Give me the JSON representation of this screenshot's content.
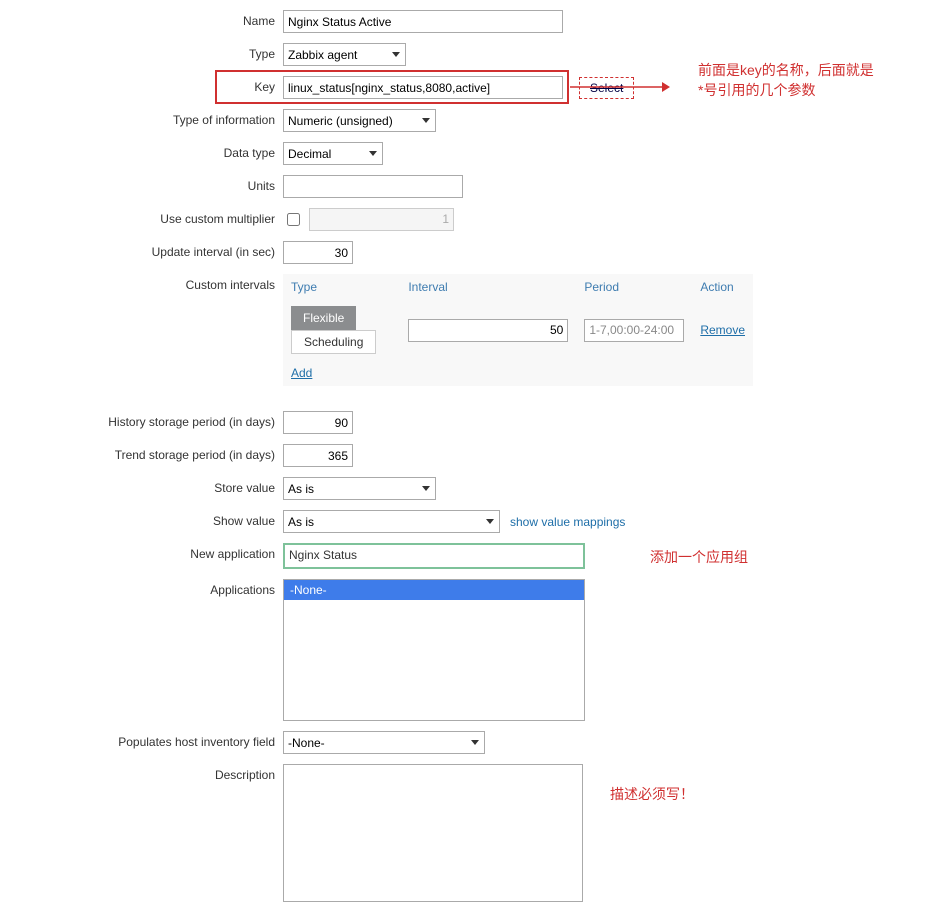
{
  "labels": {
    "name": "Name",
    "type": "Type",
    "key": "Key",
    "infoType": "Type of information",
    "dataType": "Data type",
    "units": "Units",
    "customMul": "Use custom multiplier",
    "updateInt": "Update interval (in sec)",
    "customInt": "Custom intervals",
    "history": "History storage period (in days)",
    "trend": "Trend storage period (in days)",
    "storeValue": "Store value",
    "showValue": "Show value",
    "newApp": "New application",
    "apps": "Applications",
    "populates": "Populates host inventory field",
    "description": "Description"
  },
  "values": {
    "name": "Nginx Status Active",
    "type": "Zabbix agent",
    "key": "linux_status[nginx_status,8080,active]",
    "infoType": "Numeric (unsigned)",
    "dataType": "Decimal",
    "units": "",
    "multiplier": "1",
    "updateInt": "30",
    "history": "90",
    "trend": "365",
    "storeValue": "As is",
    "showValue": "As is",
    "newApp": "Nginx Status",
    "populates": "-None-"
  },
  "buttons": {
    "select": "Select"
  },
  "intervals": {
    "hdr_type": "Type",
    "hdr_interval": "Interval",
    "hdr_period": "Period",
    "hdr_action": "Action",
    "tab_flexible": "Flexible",
    "tab_scheduling": "Scheduling",
    "interval_val": "50",
    "period_val": "1-7,00:00-24:00",
    "remove": "Remove",
    "add": "Add"
  },
  "links": {
    "mappings": "show value mappings"
  },
  "list": {
    "none": "-None-"
  },
  "annotations": {
    "key": "前面是key的名称，后面就是*号引用的几个参数",
    "app": "添加一个应用组",
    "desc": "描述必须写！"
  }
}
